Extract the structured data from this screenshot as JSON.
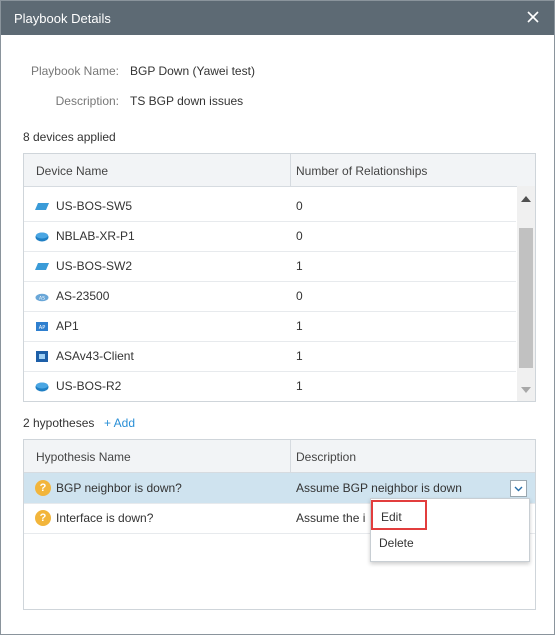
{
  "dialog": {
    "title": "Playbook Details"
  },
  "info": {
    "name_label": "Playbook Name:",
    "name_value": "BGP Down (Yawei test)",
    "desc_label": "Description:",
    "desc_value": "TS BGP down issues"
  },
  "devices": {
    "summary": "8 devices applied",
    "col_name": "Device Name",
    "col_rel": "Number of Relationships",
    "rows": [
      {
        "name": "US-BOS-SW5",
        "count": "0",
        "icon": "switch-icon",
        "color": "#3a9bd8"
      },
      {
        "name": "NBLAB-XR-P1",
        "count": "0",
        "icon": "router-icon",
        "color": "#1f7fc4"
      },
      {
        "name": "US-BOS-SW2",
        "count": "1",
        "icon": "switch-icon",
        "color": "#3a9bd8"
      },
      {
        "name": "AS-23500",
        "count": "0",
        "icon": "cloud-icon",
        "color": "#6aa7d8"
      },
      {
        "name": "AP1",
        "count": "1",
        "icon": "access-point-icon",
        "color": "#2e7fcf"
      },
      {
        "name": "ASAv43-Client",
        "count": "1",
        "icon": "firewall-icon",
        "color": "#1d5fa8"
      },
      {
        "name": "US-BOS-R2",
        "count": "1",
        "icon": "router-icon",
        "color": "#1f7fc4"
      }
    ]
  },
  "hypotheses": {
    "summary": "2 hypotheses",
    "add_label": "+ Add",
    "col_name": "Hypothesis Name",
    "col_desc": "Description",
    "rows": [
      {
        "name": "BGP neighbor is down?",
        "desc": "Assume BGP neighbor is down"
      },
      {
        "name": "Interface is down?",
        "desc": "Assume the i"
      }
    ]
  },
  "menu": {
    "edit_label": "Edit",
    "delete_label": "Delete"
  },
  "colors": {
    "titlebar": "#5d6a74",
    "accent": "#2a8fd6",
    "selected_row": "#cfe3ef",
    "highlight": "#e23d3d"
  }
}
